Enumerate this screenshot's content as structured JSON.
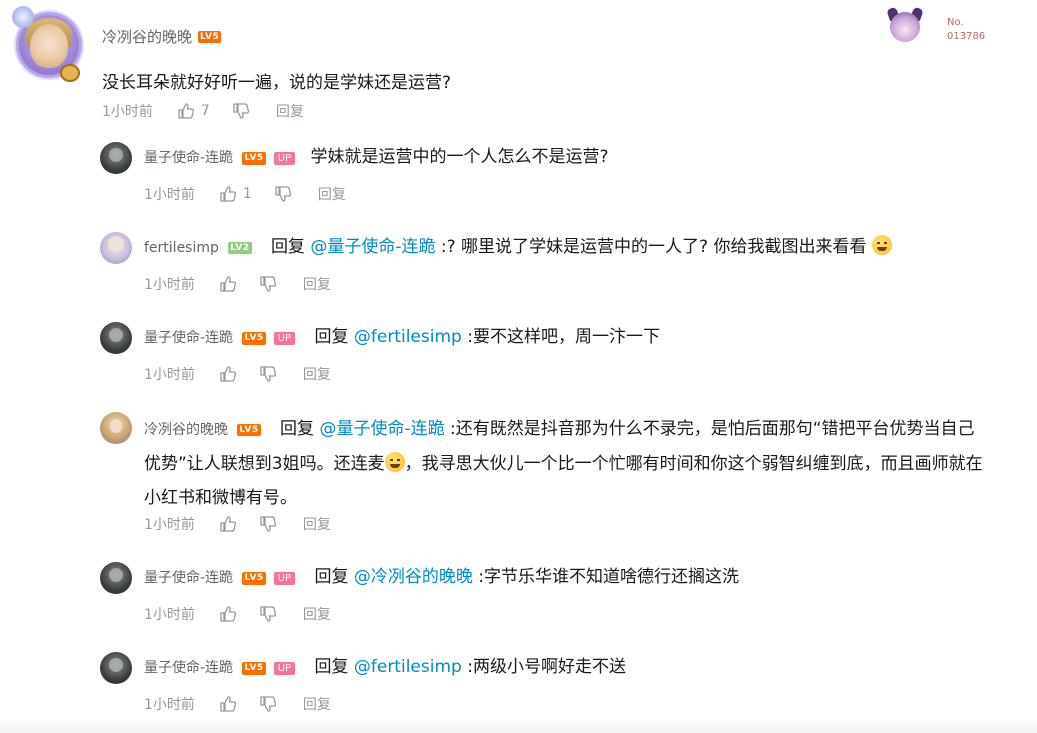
{
  "main_comment": {
    "username": "冷冽谷的晚晚",
    "level": "LV5",
    "text": "没长耳朵就好好听一遍，说的是学妹还是运营?",
    "time": "1小时前",
    "likes": "7",
    "reply_label": "回复"
  },
  "decoration": {
    "no_label": "No.",
    "no_number": "013786"
  },
  "replies": [
    {
      "username": "量子使命-连跪",
      "level": "LV5",
      "up": "UP",
      "reply_word": "",
      "mention": "",
      "text": "学妹就是运营中的一个人怎么不是运营?",
      "time": "1小时前",
      "likes": "1",
      "reply_label": "回复"
    },
    {
      "username": "fertilesimp",
      "level": "LV2",
      "reply_word": "回复",
      "mention": "@量子使命-连跪",
      "text": ":? 哪里说了学妹是运营中的一人了? 你给我截图出来看看",
      "time": "1小时前",
      "reply_label": "回复"
    },
    {
      "username": "量子使命-连跪",
      "level": "LV5",
      "up": "UP",
      "reply_word": "回复",
      "mention": "@fertilesimp",
      "text": ":要不这样吧，周一汴一下",
      "time": "1小时前",
      "reply_label": "回复"
    },
    {
      "username": "冷冽谷的晚晚",
      "level": "LV5",
      "reply_word": "回复",
      "mention": "@量子使命-连跪",
      "text_a": ":还有既然是抖音那为什么不录完，是怕后面那句“错把平台优势当自己优势”让人联想到3姐吗。还连麦",
      "text_b": "，我寻思大伙儿一个比一个忙哪有时间和你这个弱智纠缠到底，而且画师就在小红书和微博有号。",
      "time": "1小时前",
      "reply_label": "回复"
    },
    {
      "username": "量子使命-连跪",
      "level": "LV5",
      "up": "UP",
      "reply_word": "回复",
      "mention": "@冷冽谷的晚晚",
      "text": ":字节乐华谁不知道啥德行还搁这洗",
      "time": "1小时前",
      "reply_label": "回复"
    },
    {
      "username": "量子使命-连跪",
      "level": "LV5",
      "up": "UP",
      "reply_word": "回复",
      "mention": "@fertilesimp",
      "text": ":两级小号啊好走不送",
      "time": "1小时前",
      "reply_label": "回复"
    }
  ],
  "icons": {
    "like": "thumbs-up-icon",
    "dislike": "thumbs-down-icon",
    "emoji_grin": "grinning-face-emoji",
    "emoji_laugh": "rolling-laughing-emoji"
  },
  "colors": {
    "mention": "#008ac5",
    "level_badge": "#ff6c00",
    "up_badge": "#fb7299",
    "meta_text": "#9499a0"
  }
}
